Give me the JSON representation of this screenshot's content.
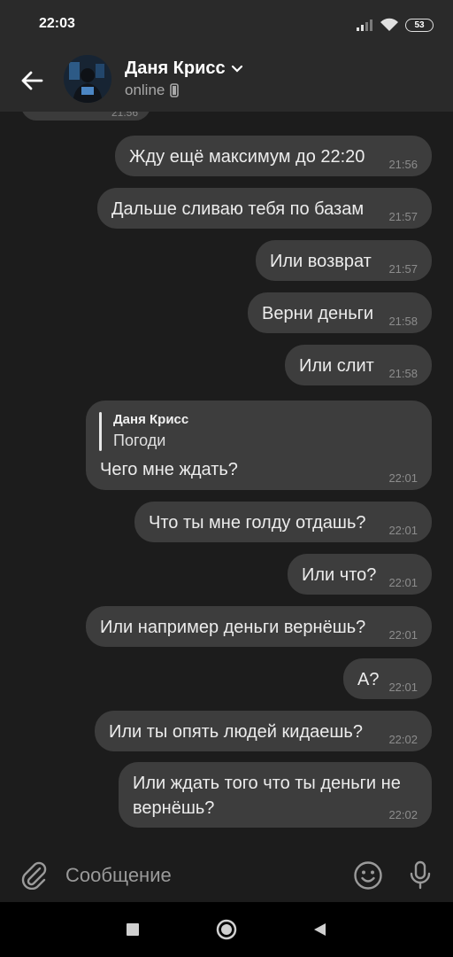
{
  "status_bar": {
    "time": "22:03",
    "battery": "53"
  },
  "header": {
    "contact_name": "Даня Крисс",
    "contact_status": "online"
  },
  "chat": {
    "partial_time": "21:56",
    "messages": [
      {
        "text": "Жду ещё максимум до 22:20",
        "time": "21:56"
      },
      {
        "text": "Дальше сливаю тебя по базам",
        "time": "21:57"
      },
      {
        "text": "Или возврат",
        "time": "21:57"
      },
      {
        "text": "Верни деньги",
        "time": "21:58"
      },
      {
        "text": "Или слит",
        "time": "21:58"
      },
      {
        "reply_author": "Даня Крисс",
        "reply_text": "Погоди",
        "text": "Чего мне ждать?",
        "time": "22:01"
      },
      {
        "text": "Что ты мне голду отдашь?",
        "time": "22:01"
      },
      {
        "text": "Или что?",
        "time": "22:01"
      },
      {
        "text": "Или например деньги вернёшь?",
        "time": "22:01"
      },
      {
        "text": "А?",
        "time": "22:01"
      },
      {
        "text": "Или ты опять людей кидаешь?",
        "time": "22:02"
      },
      {
        "text_line1": "Или ждать того что ты деньги не",
        "text_line2": "вернёшь?",
        "time": "22:02"
      }
    ]
  },
  "composer": {
    "placeholder": "Сообщение"
  },
  "icons": {
    "back": "arrow-left-icon",
    "chevron": "chevron-down-icon",
    "device": "phone-icon",
    "attach": "paperclip-icon",
    "emoji": "smiley-icon",
    "mic": "microphone-icon",
    "nav_recents": "square-icon",
    "nav_home": "circle-icon",
    "nav_back": "triangle-icon"
  },
  "colors": {
    "background": "#1c1c1c",
    "header": "#2a2a2a",
    "bubble": "#3d3d3d",
    "nav": "#000000"
  }
}
